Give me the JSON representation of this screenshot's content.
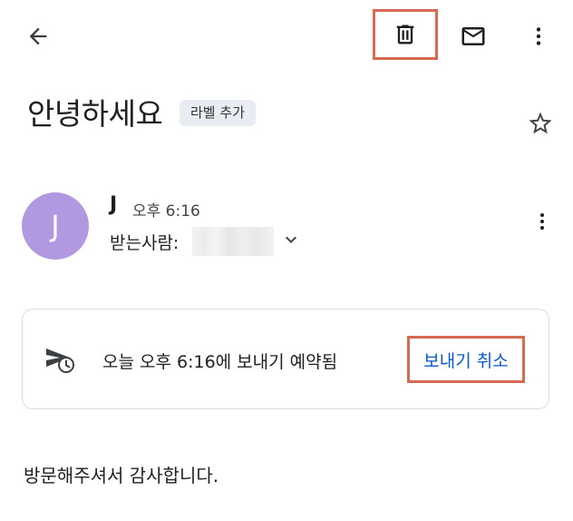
{
  "toolbar": {
    "back_icon": "arrow-left-icon",
    "delete_icon": "trash-icon",
    "mark_unread_icon": "mail-icon",
    "more_icon": "more-vert-icon"
  },
  "email": {
    "subject": "안녕하세요",
    "label_chip": "라벨 추가",
    "star_icon": "star-outline-icon"
  },
  "sender": {
    "avatar_initial": "J",
    "avatar_color": "#b198e0",
    "name": "J",
    "time": "오후 6:16",
    "recipient_label": "받는사람:",
    "expand_icon": "chevron-down-icon",
    "more_icon": "more-vert-icon"
  },
  "schedule": {
    "icon": "scheduled-send-icon",
    "text": "오늘 오후 6:16에 보내기 예약됨",
    "cancel_label": "보내기 취소"
  },
  "body": {
    "text": "방문해주셔서 감사합니다."
  },
  "colors": {
    "accent": "#0b57d0",
    "highlight_border": "#d46a4f",
    "chip_bg": "#e9ecf2"
  }
}
